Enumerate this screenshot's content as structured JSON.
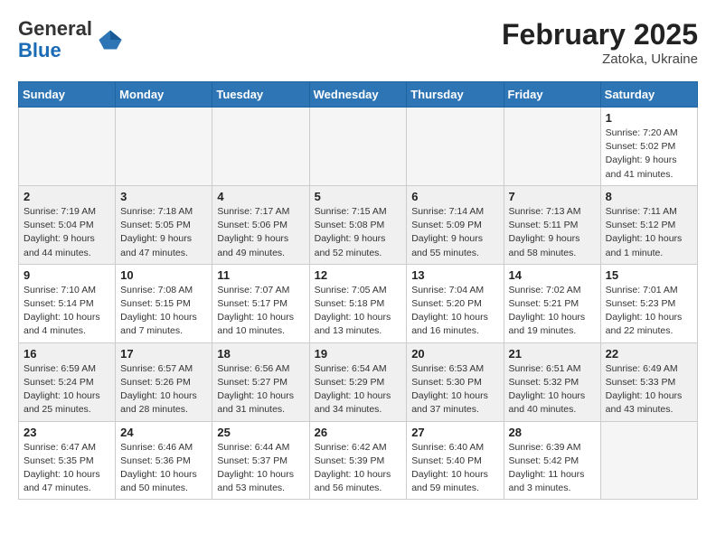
{
  "header": {
    "logo_general": "General",
    "logo_blue": "Blue",
    "month_year": "February 2025",
    "location": "Zatoka, Ukraine"
  },
  "weekdays": [
    "Sunday",
    "Monday",
    "Tuesday",
    "Wednesday",
    "Thursday",
    "Friday",
    "Saturday"
  ],
  "weeks": [
    {
      "shaded": false,
      "days": [
        {
          "num": "",
          "info": ""
        },
        {
          "num": "",
          "info": ""
        },
        {
          "num": "",
          "info": ""
        },
        {
          "num": "",
          "info": ""
        },
        {
          "num": "",
          "info": ""
        },
        {
          "num": "",
          "info": ""
        },
        {
          "num": "1",
          "info": "Sunrise: 7:20 AM\nSunset: 5:02 PM\nDaylight: 9 hours and 41 minutes."
        }
      ]
    },
    {
      "shaded": true,
      "days": [
        {
          "num": "2",
          "info": "Sunrise: 7:19 AM\nSunset: 5:04 PM\nDaylight: 9 hours and 44 minutes."
        },
        {
          "num": "3",
          "info": "Sunrise: 7:18 AM\nSunset: 5:05 PM\nDaylight: 9 hours and 47 minutes."
        },
        {
          "num": "4",
          "info": "Sunrise: 7:17 AM\nSunset: 5:06 PM\nDaylight: 9 hours and 49 minutes."
        },
        {
          "num": "5",
          "info": "Sunrise: 7:15 AM\nSunset: 5:08 PM\nDaylight: 9 hours and 52 minutes."
        },
        {
          "num": "6",
          "info": "Sunrise: 7:14 AM\nSunset: 5:09 PM\nDaylight: 9 hours and 55 minutes."
        },
        {
          "num": "7",
          "info": "Sunrise: 7:13 AM\nSunset: 5:11 PM\nDaylight: 9 hours and 58 minutes."
        },
        {
          "num": "8",
          "info": "Sunrise: 7:11 AM\nSunset: 5:12 PM\nDaylight: 10 hours and 1 minute."
        }
      ]
    },
    {
      "shaded": false,
      "days": [
        {
          "num": "9",
          "info": "Sunrise: 7:10 AM\nSunset: 5:14 PM\nDaylight: 10 hours and 4 minutes."
        },
        {
          "num": "10",
          "info": "Sunrise: 7:08 AM\nSunset: 5:15 PM\nDaylight: 10 hours and 7 minutes."
        },
        {
          "num": "11",
          "info": "Sunrise: 7:07 AM\nSunset: 5:17 PM\nDaylight: 10 hours and 10 minutes."
        },
        {
          "num": "12",
          "info": "Sunrise: 7:05 AM\nSunset: 5:18 PM\nDaylight: 10 hours and 13 minutes."
        },
        {
          "num": "13",
          "info": "Sunrise: 7:04 AM\nSunset: 5:20 PM\nDaylight: 10 hours and 16 minutes."
        },
        {
          "num": "14",
          "info": "Sunrise: 7:02 AM\nSunset: 5:21 PM\nDaylight: 10 hours and 19 minutes."
        },
        {
          "num": "15",
          "info": "Sunrise: 7:01 AM\nSunset: 5:23 PM\nDaylight: 10 hours and 22 minutes."
        }
      ]
    },
    {
      "shaded": true,
      "days": [
        {
          "num": "16",
          "info": "Sunrise: 6:59 AM\nSunset: 5:24 PM\nDaylight: 10 hours and 25 minutes."
        },
        {
          "num": "17",
          "info": "Sunrise: 6:57 AM\nSunset: 5:26 PM\nDaylight: 10 hours and 28 minutes."
        },
        {
          "num": "18",
          "info": "Sunrise: 6:56 AM\nSunset: 5:27 PM\nDaylight: 10 hours and 31 minutes."
        },
        {
          "num": "19",
          "info": "Sunrise: 6:54 AM\nSunset: 5:29 PM\nDaylight: 10 hours and 34 minutes."
        },
        {
          "num": "20",
          "info": "Sunrise: 6:53 AM\nSunset: 5:30 PM\nDaylight: 10 hours and 37 minutes."
        },
        {
          "num": "21",
          "info": "Sunrise: 6:51 AM\nSunset: 5:32 PM\nDaylight: 10 hours and 40 minutes."
        },
        {
          "num": "22",
          "info": "Sunrise: 6:49 AM\nSunset: 5:33 PM\nDaylight: 10 hours and 43 minutes."
        }
      ]
    },
    {
      "shaded": false,
      "days": [
        {
          "num": "23",
          "info": "Sunrise: 6:47 AM\nSunset: 5:35 PM\nDaylight: 10 hours and 47 minutes."
        },
        {
          "num": "24",
          "info": "Sunrise: 6:46 AM\nSunset: 5:36 PM\nDaylight: 10 hours and 50 minutes."
        },
        {
          "num": "25",
          "info": "Sunrise: 6:44 AM\nSunset: 5:37 PM\nDaylight: 10 hours and 53 minutes."
        },
        {
          "num": "26",
          "info": "Sunrise: 6:42 AM\nSunset: 5:39 PM\nDaylight: 10 hours and 56 minutes."
        },
        {
          "num": "27",
          "info": "Sunrise: 6:40 AM\nSunset: 5:40 PM\nDaylight: 10 hours and 59 minutes."
        },
        {
          "num": "28",
          "info": "Sunrise: 6:39 AM\nSunset: 5:42 PM\nDaylight: 11 hours and 3 minutes."
        },
        {
          "num": "",
          "info": ""
        }
      ]
    }
  ]
}
